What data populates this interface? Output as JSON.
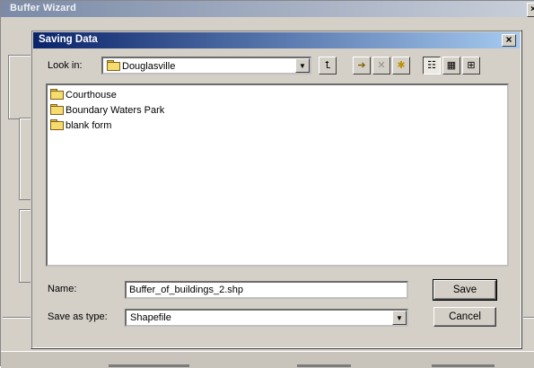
{
  "background_window": {
    "title": "Buffer Wizard",
    "close_label": "×"
  },
  "dialog": {
    "title": "Saving Data",
    "close_label": "×",
    "look_in": {
      "label": "Look in:",
      "value": "Douglasville",
      "arrow": "▼"
    },
    "toolbar": [
      {
        "name": "up-one-level-icon",
        "glyph": "⮤"
      },
      {
        "name": "connect-folder-icon",
        "glyph": "➔"
      },
      {
        "name": "disconnect-folder-icon",
        "glyph": "✕"
      },
      {
        "name": "new-folder-icon",
        "glyph": "✱"
      },
      {
        "name": "list-view-icon",
        "glyph": "☷"
      },
      {
        "name": "details-view-icon",
        "glyph": "▦"
      },
      {
        "name": "thumbnails-view-icon",
        "glyph": "⊞"
      }
    ],
    "files": [
      {
        "name": "Courthouse"
      },
      {
        "name": "Boundary Waters Park"
      },
      {
        "name": "blank form"
      }
    ],
    "name_field": {
      "label": "Name:",
      "value": "Buffer_of_buildings_2.shp"
    },
    "save_as_type": {
      "label": "Save as type:",
      "value": "Shapefile",
      "arrow": "▼"
    },
    "buttons": {
      "save": "Save",
      "cancel": "Cancel"
    }
  }
}
